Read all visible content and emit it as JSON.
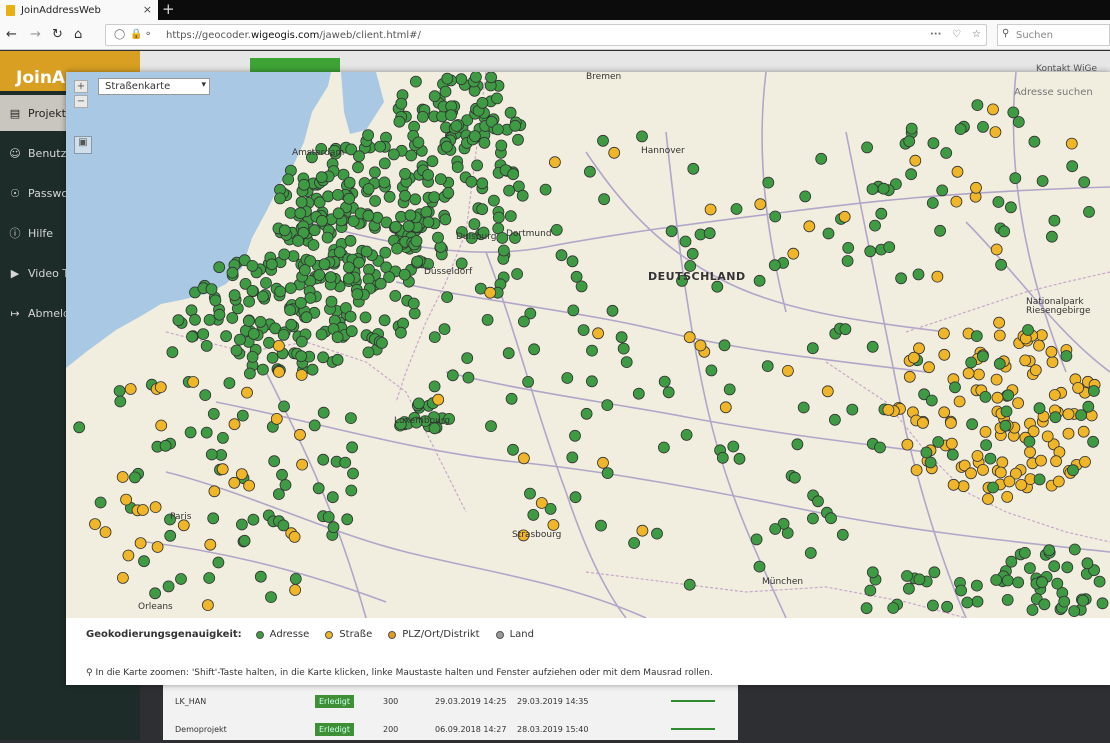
{
  "browser": {
    "tab_title": "JoinAddressWeb",
    "url_prefix": "https://geocoder.",
    "url_domain": "wigeogis.com",
    "url_path": "/jaweb/client.html#/",
    "search_placeholder": "Suchen",
    "new_tab": "+",
    "close_tab": "×"
  },
  "app": {
    "logo_text": "JoinA",
    "kontakt": "Kontakt WiGe",
    "sidebar": [
      {
        "icon": "document-icon",
        "label": "Projekte"
      },
      {
        "icon": "user-icon",
        "label": "Benutzer"
      },
      {
        "icon": "lock-icon",
        "label": "Passwort"
      },
      {
        "icon": "info-icon",
        "label": "Hilfe"
      },
      {
        "icon": "video-icon",
        "label": "Video Tu"
      },
      {
        "icon": "logout-icon",
        "label": "Abmelden"
      }
    ]
  },
  "map": {
    "layer_select": "Straßenkarte",
    "zoom_in": "+",
    "zoom_out": "−",
    "address_search": "Adresse suchen",
    "labels": {
      "germany": "DEUTSCHLAND",
      "amsterdam": "Amsterdam",
      "duisburg": "Duisburg",
      "dortmund": "Dortmund",
      "duesseldorf": "Düsseldorf",
      "hannover": "Hannover",
      "luxembourg": "Luxembourg",
      "paris": "Paris",
      "orleans": "Orleans",
      "muenchen": "München",
      "strasbourg": "Strasbourg",
      "nationalpark": "Nationalpark Riesengebirge",
      "bremen": "Bremen"
    }
  },
  "legend": {
    "title": "Geokodierungsgenauigkeit:",
    "items": [
      {
        "label": "Adresse",
        "color": "#3e9b44"
      },
      {
        "label": "Straße",
        "color": "#f0b62a"
      },
      {
        "label": "PLZ/Ort/Distrikt",
        "color": "#e39a22"
      },
      {
        "label": "Land",
        "color": "#9a9a9a"
      }
    ]
  },
  "hint": "In die Karte zoomen: 'Shift'-Taste halten, in die Karte klicken, linke Maustaste halten und Fenster aufziehen oder mit dem Mausrad rollen.",
  "table": {
    "rows": [
      {
        "name": "LK_HAN",
        "status": "Erledigt",
        "count": "300",
        "created": "29.03.2019 14:25",
        "updated": "29.03.2019 14:35"
      },
      {
        "name": "Demoprojekt",
        "status": "Erledigt",
        "count": "200",
        "created": "06.09.2018 14:27",
        "updated": "28.03.2019 15:40"
      }
    ]
  }
}
